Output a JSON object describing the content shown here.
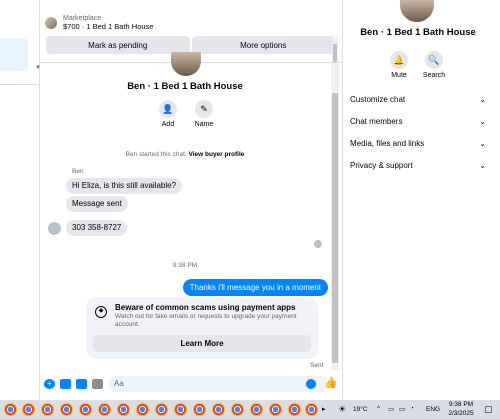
{
  "listing": {
    "category": "Marketplace",
    "title": "$700 · 1 Bed 1 Bath House"
  },
  "actions": {
    "mark_pending": "Mark as pending",
    "more_options": "More options"
  },
  "chat": {
    "title": "Ben · 1 Bed 1 Bath House",
    "add_label": "Add",
    "name_label": "Name",
    "started_text": "Ben started this chat.",
    "view_profile": "View buyer profile",
    "sender": "Ben",
    "messages_in": [
      "Hi Eliza, is this still available?",
      "Message sent",
      "303 358-8727"
    ],
    "time": "9:38 PM",
    "message_out": "Thanks i'll message you in a moment",
    "status": "Sent"
  },
  "warning": {
    "title": "Beware of common scams using payment apps",
    "body": "Watch out for fake emails or requests to upgrade your payment account.",
    "button": "Learn More"
  },
  "composer": {
    "placeholder": "Aa"
  },
  "panel": {
    "title": "Ben · 1 Bed 1 Bath House",
    "mute_label": "Mute",
    "search_label": "Search",
    "sections": [
      "Customize chat",
      "Chat members",
      "Media, files and links",
      "Privacy & support"
    ]
  },
  "taskbar": {
    "temperature": "19°C",
    "language": "ENG",
    "time": "9:38 PM",
    "date": "2/3/2025"
  },
  "colors": {
    "accent": "#0084ff",
    "bubble_in": "#e4e6eb"
  }
}
